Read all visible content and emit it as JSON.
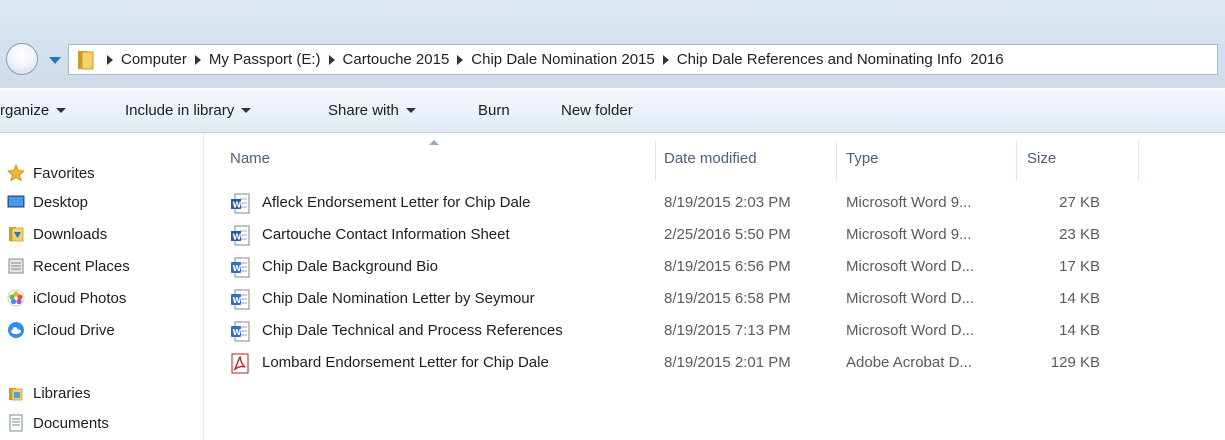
{
  "address_bar": {
    "breadcrumbs": [
      "Computer",
      "My Passport (E:)",
      "Cartouche 2015",
      "Chip Dale Nomination 2015",
      "Chip Dale References and Nominating Info  2016"
    ]
  },
  "toolbar": {
    "organize": "rganize",
    "include_in_library": "Include in library",
    "share_with": "Share with",
    "burn": "Burn",
    "new_folder": "New folder"
  },
  "nav": {
    "favorites": "Favorites",
    "desktop": "Desktop",
    "downloads": "Downloads",
    "recent_places": "Recent Places",
    "icloud_photos": "iCloud Photos",
    "icloud_drive": "iCloud Drive",
    "libraries": "Libraries",
    "documents": "Documents"
  },
  "columns": {
    "name": "Name",
    "date_modified": "Date modified",
    "type": "Type",
    "size": "Size"
  },
  "files": [
    {
      "name": "Afleck Endorsement Letter for Chip Dale",
      "date": "8/19/2015 2:03 PM",
      "type": "Microsoft Word 9...",
      "size": "27 KB",
      "icon": "word-97-doc-icon"
    },
    {
      "name": "Cartouche Contact Information Sheet",
      "date": "2/25/2016 5:50 PM",
      "type": "Microsoft Word 9...",
      "size": "23 KB",
      "icon": "word-97-doc-icon"
    },
    {
      "name": "Chip Dale Background Bio",
      "date": "8/19/2015 6:56 PM",
      "type": "Microsoft Word D...",
      "size": "17 KB",
      "icon": "word-docx-icon"
    },
    {
      "name": "Chip Dale Nomination Letter by Seymour",
      "date": "8/19/2015 6:58 PM",
      "type": "Microsoft Word D...",
      "size": "14 KB",
      "icon": "word-docx-icon"
    },
    {
      "name": "Chip Dale Technical and Process References",
      "date": "8/19/2015 7:13 PM",
      "type": "Microsoft Word D...",
      "size": "14 KB",
      "icon": "word-docx-icon"
    },
    {
      "name": "Lombard Endorsement Letter for Chip Dale",
      "date": "8/19/2015 2:01 PM",
      "type": "Adobe Acrobat D...",
      "size": "129 KB",
      "icon": "pdf-icon"
    }
  ],
  "colors": {
    "accent": "#1e78c8",
    "column_header_text": "#4c607a"
  }
}
